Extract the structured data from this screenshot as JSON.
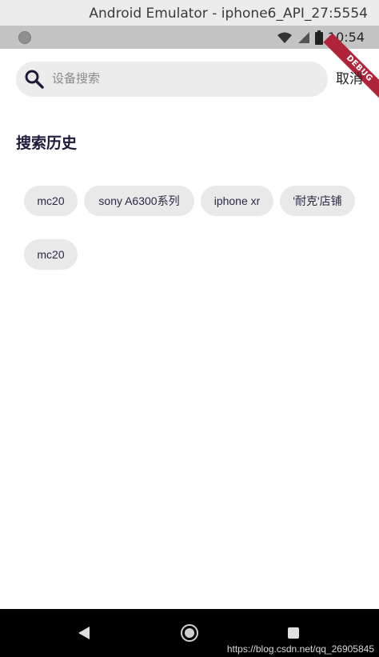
{
  "window": {
    "title": "Android Emulator - iphone6_API_27:5554"
  },
  "status_bar": {
    "time": "10:54",
    "debug_banner": "DEBUG"
  },
  "search": {
    "placeholder": "设备搜索",
    "cancel_label": "取消"
  },
  "history": {
    "title": "搜索历史",
    "items": [
      "mc20",
      "sony A6300系列",
      "iphone xr",
      "'耐克'店铺",
      "mc20"
    ]
  },
  "navigation": {
    "watermark": "https://blog.csdn.net/qq_26905845"
  },
  "colors": {
    "accent": "#1e1b3c",
    "chip_bg": "#e9e9e9",
    "search_bg": "#ececec",
    "debug_ribbon": "#b0243a"
  }
}
